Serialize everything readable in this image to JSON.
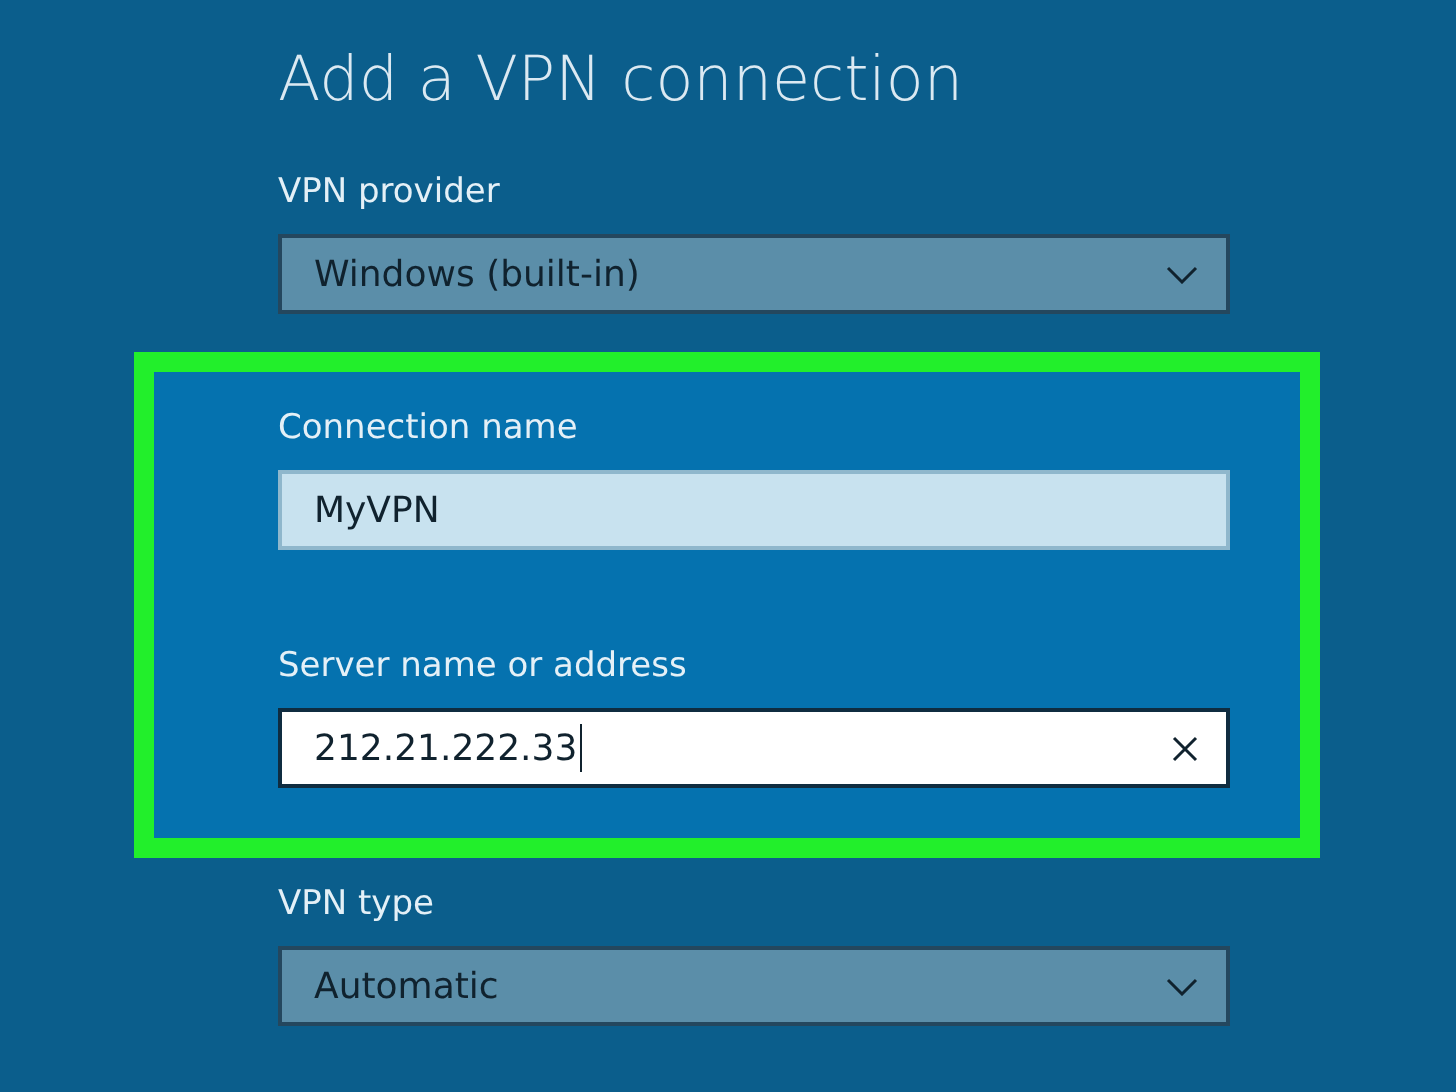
{
  "title": "Add a VPN connection",
  "sections": [
    {
      "kind": "plain",
      "fields": [
        {
          "label": "VPN provider",
          "kind": "dropdown",
          "value": "Windows (built-in)"
        }
      ]
    },
    {
      "kind": "highlighted",
      "fields": [
        {
          "label": "Connection name",
          "kind": "text",
          "value": "MyVPN",
          "focused": false
        },
        {
          "label": "Server name or address",
          "kind": "text",
          "value": "212.21.222.33",
          "focused": true
        }
      ]
    },
    {
      "kind": "plain",
      "fields": [
        {
          "label": "VPN type",
          "kind": "dropdown",
          "value": "Automatic"
        }
      ]
    }
  ]
}
